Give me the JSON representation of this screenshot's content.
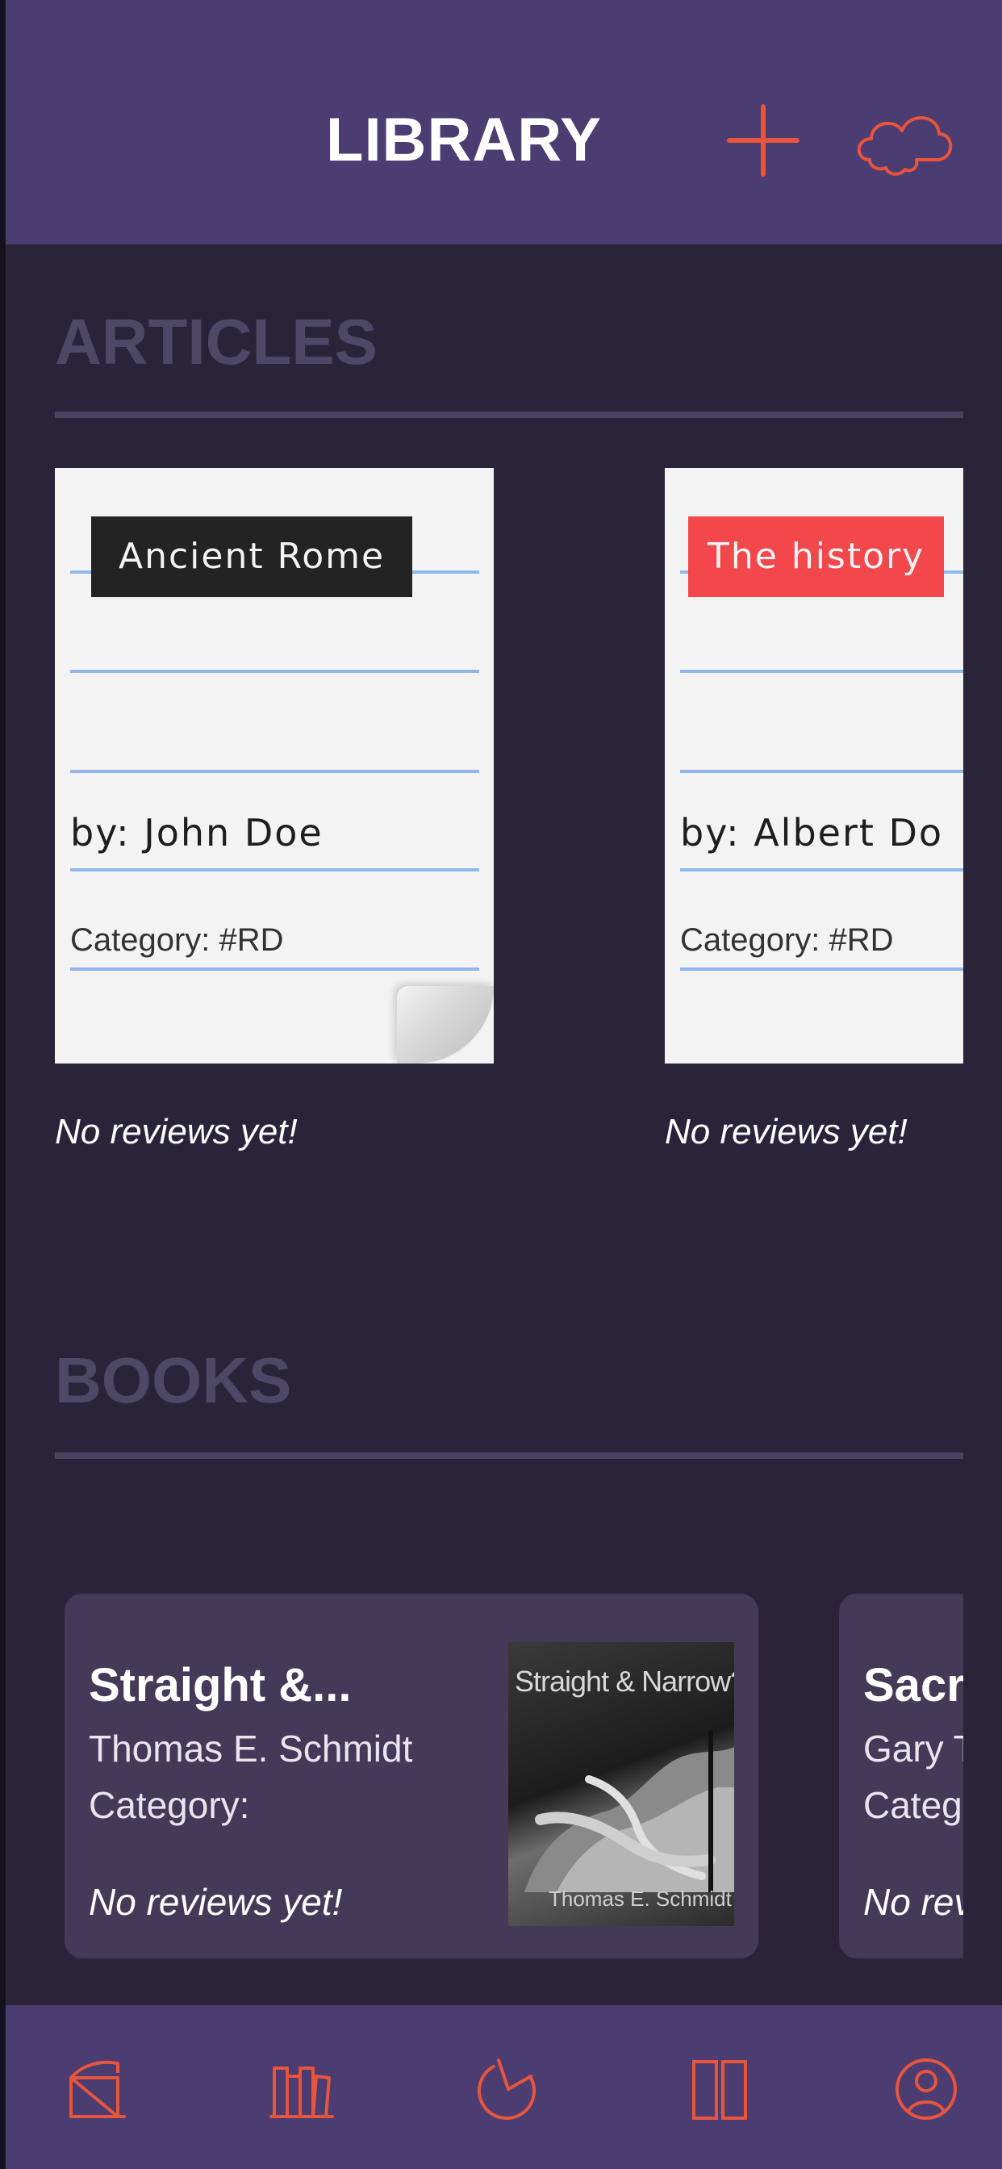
{
  "header": {
    "title": "LIBRARY",
    "add_icon": "plus-icon",
    "cloud_icon": "cloud-icon",
    "accent_color": "#e8553d"
  },
  "articles": {
    "section_title": "ARTICLES",
    "items": [
      {
        "tag": "Ancient Rome",
        "tag_color": "#232323",
        "author": "by: John Doe",
        "category": "Category: #RD",
        "reviews": "No reviews yet!"
      },
      {
        "tag": "The history",
        "tag_color": "#f2484c",
        "author": "by: Albert Do",
        "category": "Category: #RD",
        "reviews": "No reviews yet!"
      }
    ]
  },
  "books": {
    "section_title": "BOOKS",
    "items": [
      {
        "title": "Straight &...",
        "author": "Thomas E. Schmidt",
        "category": "Category:",
        "reviews": "No reviews yet!",
        "cover_title": "Straight & Narrow?",
        "cover_author": "Thomas E. Schmidt"
      },
      {
        "title": "Sacr",
        "author": "Gary T",
        "category": "Categ",
        "reviews": "No rev"
      }
    ]
  },
  "tabbar": {
    "tabs": [
      {
        "icon": "home-icon"
      },
      {
        "icon": "library-icon"
      },
      {
        "icon": "stats-icon"
      },
      {
        "icon": "reading-icon"
      },
      {
        "icon": "profile-icon"
      }
    ]
  },
  "colors": {
    "header_bg": "#4b3c72",
    "page_bg": "#29243a",
    "section_heading": "#4e4867",
    "book_card": "#433a58"
  }
}
